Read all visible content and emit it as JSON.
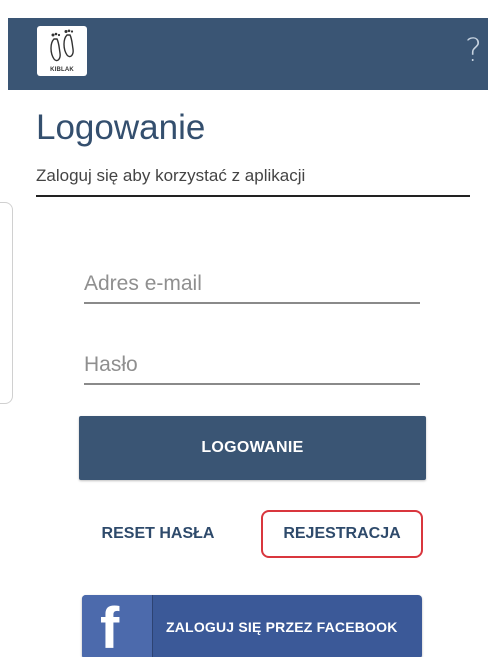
{
  "header": {
    "logo_text": "KIBLAK",
    "help_label": "?"
  },
  "main": {
    "title": "Logowanie",
    "subtitle": "Zaloguj się aby korzystać z aplikacji"
  },
  "form": {
    "email_placeholder": "Adres e-mail",
    "password_placeholder": "Hasło",
    "login_label": "LOGOWANIE"
  },
  "links": {
    "reset_label": "RESET HASŁA",
    "register_label": "REJESTRACJA"
  },
  "facebook": {
    "icon_glyph": "f",
    "label": "ZALOGUJ SIĘ PRZEZ FACEBOOK"
  },
  "colors": {
    "primary": "#3a5574",
    "facebook": "#3b5998",
    "highlight": "#d9363e"
  }
}
